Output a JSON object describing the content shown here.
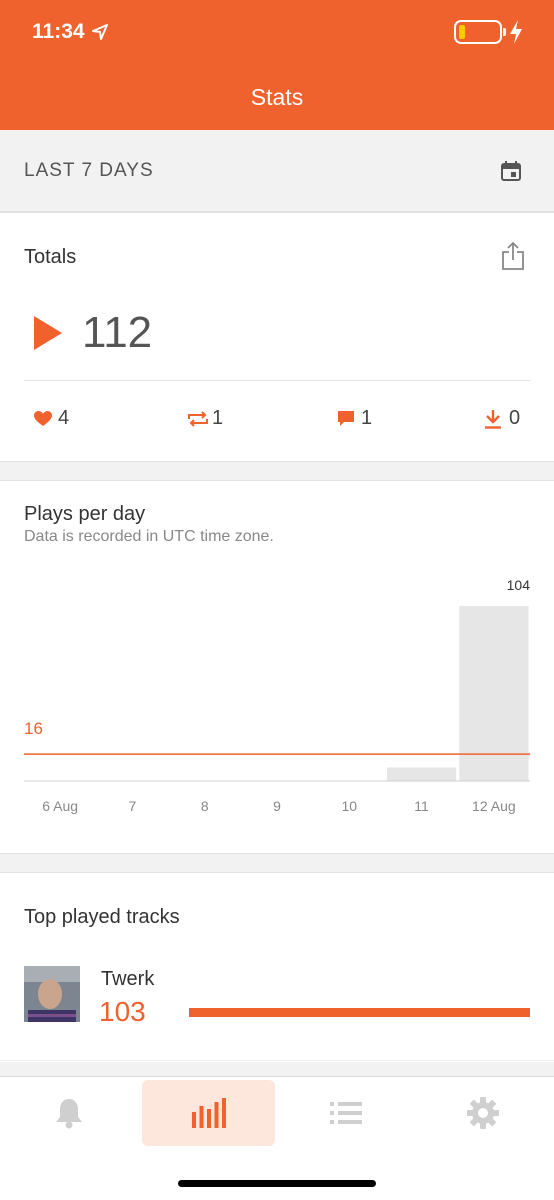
{
  "status_bar": {
    "time": "11:34"
  },
  "header": {
    "title": "Stats"
  },
  "period": {
    "label": "LAST 7 DAYS"
  },
  "totals": {
    "title": "Totals",
    "plays": "112",
    "likes": "4",
    "reposts": "1",
    "comments": "1",
    "downloads": "0"
  },
  "plays_per_day": {
    "title": "Plays per day",
    "subtitle": "Data is recorded in UTC time zone."
  },
  "chart_data": {
    "type": "bar",
    "categories": [
      "6 Aug",
      "7",
      "8",
      "9",
      "10",
      "11",
      "12 Aug"
    ],
    "values": [
      0,
      0,
      0,
      0,
      0,
      8,
      104
    ],
    "value_labels": [
      "",
      "",
      "",
      "",
      "",
      "",
      "104"
    ],
    "reference_line": {
      "value": 16,
      "label": "16"
    },
    "ylim": [
      0,
      104
    ],
    "bar_color": "#e6e6e6",
    "line_color": "#f0622d"
  },
  "top_tracks": {
    "title": "Top played tracks",
    "items": [
      {
        "name": "Twerk",
        "plays": "103",
        "fraction": 1.0
      }
    ]
  },
  "tabs": [
    {
      "icon": "bell-icon",
      "active": false
    },
    {
      "icon": "stats-icon",
      "active": true
    },
    {
      "icon": "list-icon",
      "active": false
    },
    {
      "icon": "gear-icon",
      "active": false
    }
  ],
  "colors": {
    "accent": "#f0622d",
    "inactive_icon": "#cfcfcf"
  }
}
